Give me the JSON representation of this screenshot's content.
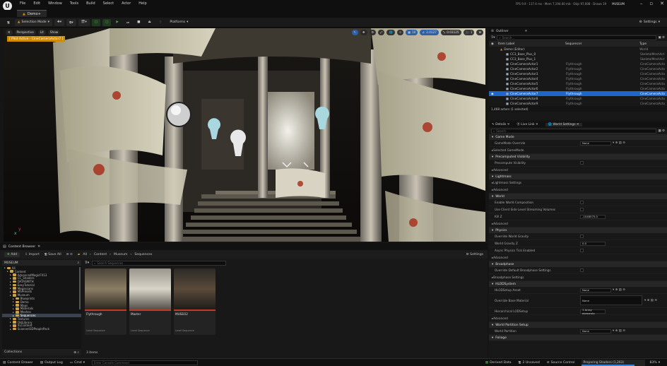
{
  "menu": {
    "items": [
      "File",
      "Edit",
      "Window",
      "Tools",
      "Build",
      "Select",
      "Actor",
      "Help"
    ],
    "stats": "FPS 9.9 · 117.4 ms · Mem 7,194.00 mb · Objs 97,608 · Draws 19",
    "project": "MUSEUM"
  },
  "doc_tab": "Demo+",
  "toolbar": {
    "mode": "Selection Mode",
    "platforms": "Platforms",
    "settings": "Settings"
  },
  "viewport": {
    "perspective": "Perspective",
    "lit": "Lit",
    "show": "Show",
    "pilot": "[ Pilot Active - CineCameraActor7 ]",
    "grid": "10",
    "rot": "10°",
    "scale": "0.03125",
    "cam": "1",
    "snap": "2.0127"
  },
  "content_browser": {
    "tab": "Content Browser",
    "add": "Add",
    "import": "Import",
    "save_all": "Save All",
    "settings": "Settings",
    "path": [
      "All",
      "Content",
      "Museum",
      "Sequences"
    ],
    "root": "MUSEUM",
    "search_placeholder": "Search Sequences",
    "items_count": "3 items",
    "collections": "Collections",
    "tree": [
      {
        "label": "All",
        "depth": 0
      },
      {
        "label": "Content",
        "depth": 1
      },
      {
        "label": "AdvancedMagicFX13",
        "depth": 2
      },
      {
        "label": "CC_Shaders",
        "depth": 2
      },
      {
        "label": "DATASMITH",
        "depth": 2
      },
      {
        "label": "EasyTutorial",
        "depth": 2
      },
      {
        "label": "Megascans",
        "depth": 2
      },
      {
        "label": "MSPresets",
        "depth": 2
      },
      {
        "label": "Museum",
        "depth": 2
      },
      {
        "label": "Blueprints",
        "depth": 3
      },
      {
        "label": "Demo",
        "depth": 3
      },
      {
        "label": "Maps",
        "depth": 3
      },
      {
        "label": "Materials",
        "depth": 3
      },
      {
        "label": "Meshes",
        "depth": 3
      },
      {
        "label": "Sequences",
        "depth": 3
      },
      {
        "label": "Textures",
        "depth": 2
      },
      {
        "label": "OldLibrary",
        "depth": 2
      },
      {
        "label": "XLContent",
        "depth": 2
      },
      {
        "label": "Scanned3DPeoplePack",
        "depth": 2
      }
    ],
    "assets": [
      {
        "name": "Flythrough",
        "type": "Level Sequence"
      },
      {
        "name": "Master",
        "type": "Level Sequence"
      },
      {
        "name": "MUSEO2",
        "type": "Level Sequence"
      }
    ]
  },
  "outliner": {
    "tab": "Outliner",
    "search_placeholder": "Search...",
    "col_label": "Item Label",
    "col_seq": "Sequencer",
    "col_type": "Type",
    "count": "1,468 actors (1 selected)",
    "rows": [
      {
        "label": "Demo (Editor)",
        "seq": "",
        "type": "World"
      },
      {
        "label": "CC3_Base_Plus_0",
        "seq": "",
        "type": "SkeletalMeshAct"
      },
      {
        "label": "CC3_Base_Plus_1",
        "seq": "",
        "type": "SkeletalMeshAct"
      },
      {
        "label": "CineCameraActor1",
        "seq": "Flythrough",
        "type": "CineCameraActo"
      },
      {
        "label": "CineCameraActor2",
        "seq": "Flythrough",
        "type": "CineCameraActo"
      },
      {
        "label": "CineCameraActor3",
        "seq": "Flythrough",
        "type": "CineCameraActo"
      },
      {
        "label": "CineCameraActor4",
        "seq": "Flythrough",
        "type": "CineCameraActo"
      },
      {
        "label": "CineCameraActor5",
        "seq": "Flythrough",
        "type": "CineCameraActo"
      },
      {
        "label": "CineCameraActor6",
        "seq": "Flythrough",
        "type": "CineCameraActo"
      },
      {
        "label": "CineCameraActor7",
        "seq": "Flythrough",
        "type": "CineCameraActo"
      },
      {
        "label": "CineCameraActor8",
        "seq": "Flythrough",
        "type": "CineCameraActo"
      },
      {
        "label": "CineCameraActor9",
        "seq": "Flythrough",
        "type": "CineCameraActo"
      }
    ]
  },
  "details": {
    "tab": "Details",
    "live_link": "Live Link",
    "world_settings": "World Settings",
    "search_placeholder": "Search",
    "rows": [
      {
        "kind": "cat",
        "label": "Game Mode"
      },
      {
        "kind": "prop",
        "label": "GameMode Override",
        "value": "None"
      },
      {
        "kind": "sub",
        "label": "Selected GameMode"
      },
      {
        "kind": "cat",
        "label": "Precomputed Visibility"
      },
      {
        "kind": "prop",
        "label": "Precompute Visibility",
        "check": true
      },
      {
        "kind": "sub",
        "label": "Advanced"
      },
      {
        "kind": "cat",
        "label": "Lightmass"
      },
      {
        "kind": "sub",
        "label": "Lightmass Settings"
      },
      {
        "kind": "sub",
        "label": "Advanced"
      },
      {
        "kind": "cat",
        "label": "World"
      },
      {
        "kind": "prop",
        "label": "Enable World Composition",
        "check": true
      },
      {
        "kind": "prop",
        "label": "Use Client Side Level Streaming Volumes",
        "check": true
      },
      {
        "kind": "prop",
        "label": "Kill Z",
        "value": "-1048575.0"
      },
      {
        "kind": "sub",
        "label": "Advanced"
      },
      {
        "kind": "cat",
        "label": "Physics"
      },
      {
        "kind": "prop",
        "label": "Override World Gravity",
        "check": true
      },
      {
        "kind": "prop",
        "label": "World Gravity Z",
        "value": "0.0"
      },
      {
        "kind": "prop",
        "label": "Async Physics Tick Enabled",
        "check": true
      },
      {
        "kind": "sub",
        "label": "Advanced"
      },
      {
        "kind": "cat",
        "label": "Broadphase"
      },
      {
        "kind": "prop",
        "label": "Override Default Broadphase Settings",
        "check": true
      },
      {
        "kind": "sub",
        "label": "Broadphase Settings"
      },
      {
        "kind": "cat",
        "label": "HLODSystem"
      },
      {
        "kind": "prop",
        "label": "HLODSetup Asset",
        "value": "None"
      },
      {
        "kind": "prop2",
        "label": "Override Base Material",
        "value": "None"
      },
      {
        "kind": "prop",
        "label": "Hierarchical LODSetup",
        "value": "1 Array elements"
      },
      {
        "kind": "sub",
        "label": "Advanced"
      },
      {
        "kind": "cat",
        "label": "World Partition Setup"
      },
      {
        "kind": "prop",
        "label": "World Partition",
        "value": "None"
      },
      {
        "kind": "cat",
        "label": "Foliage"
      }
    ]
  },
  "status": {
    "drawer": "Content Drawer",
    "output": "Output Log",
    "cmd": "Cmd",
    "console_placeholder": "Enter Console Command",
    "derived": "Derived Data",
    "unsaved": "2 Unsaved",
    "source": "Source Control",
    "shaders": "Preparing Shaders (1,263)",
    "percent": "83%"
  }
}
